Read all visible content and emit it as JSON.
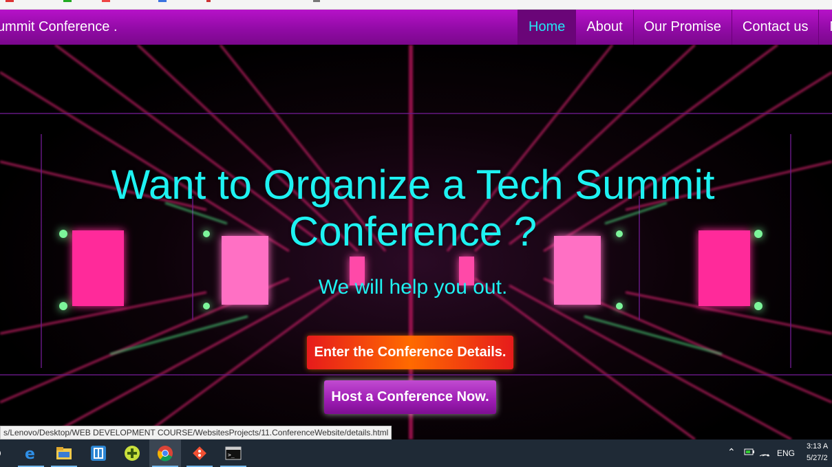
{
  "navbar": {
    "brand": "ummit Conference .",
    "links": [
      "Home",
      "About",
      "Our Promise",
      "Contact us",
      "N"
    ],
    "active": "Home"
  },
  "hero": {
    "headline_line1": "Want to Organize a Tech Summit",
    "headline_line2": "Conference ?",
    "subheadline": "We will help you out.",
    "primary_button": "Enter the Conference Details.",
    "secondary_button": "Host a Conference Now."
  },
  "status_url": "s/Lenovo/Desktop/WEB DEVELOPMENT COURSE/WebsitesProjects/11.ConferenceWebsite/details.html",
  "taskbar": {
    "apps": [
      "edge-icon",
      "file-explorer-icon",
      "app-icon",
      "plus-app-icon",
      "chrome-icon",
      "git-icon",
      "terminal-icon"
    ],
    "language": "ENG",
    "time": "3:13 A",
    "date": "5/27/2"
  },
  "colors": {
    "nav_purple": "#9b0db0",
    "accent_cyan": "#1ef2f2",
    "button_orange": "#ff6a00",
    "button_purple": "#9d1cb3"
  }
}
